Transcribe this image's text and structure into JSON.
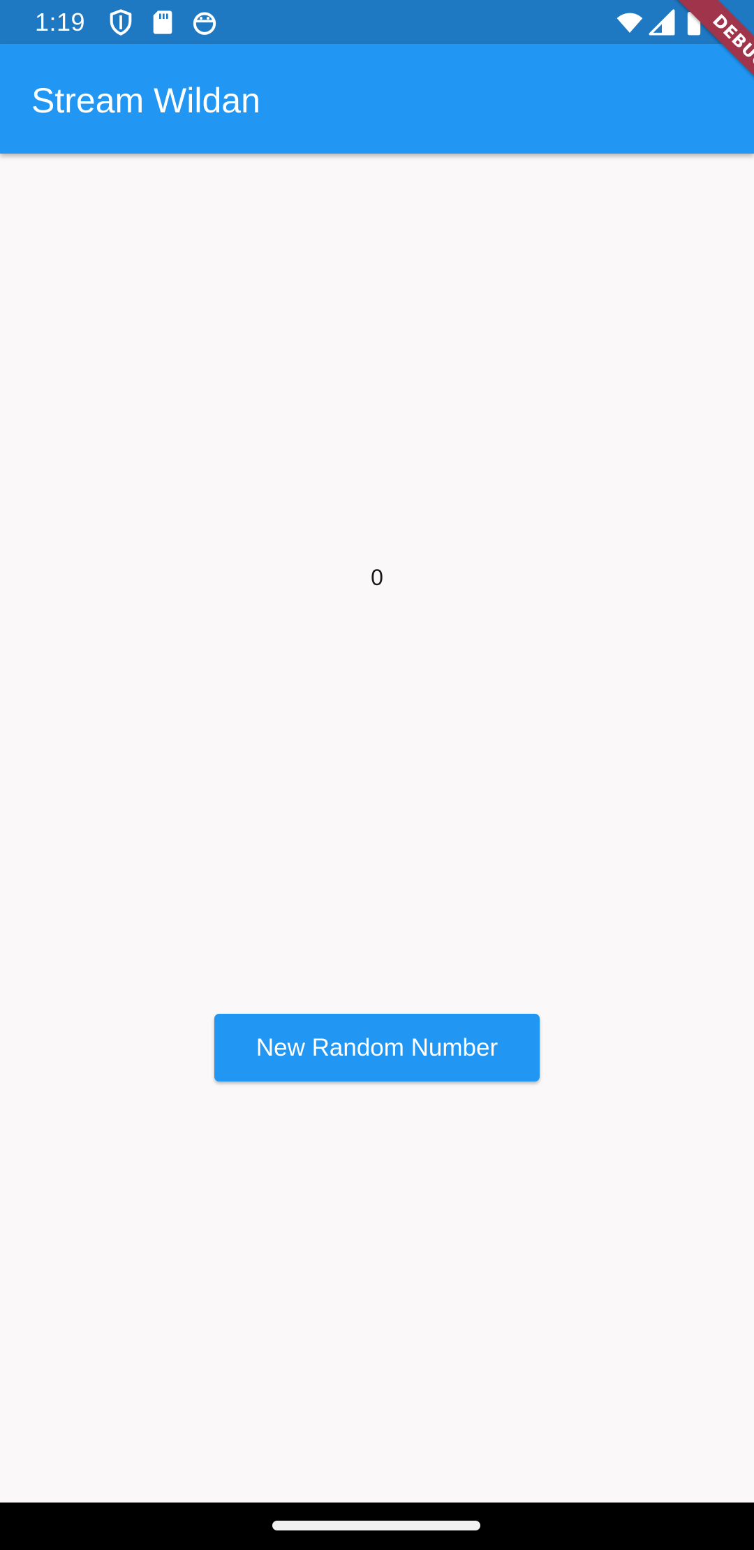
{
  "status_bar": {
    "time": "1:19",
    "left_icons": [
      "shield-icon",
      "sd-card-icon",
      "android-icon"
    ],
    "right_icons": [
      "wifi-icon",
      "cellular-signal-icon",
      "battery-icon"
    ],
    "color": "#1e78c2"
  },
  "app_bar": {
    "title": "Stream Wildan",
    "color": "#2196f3"
  },
  "debug_banner": {
    "label": "DEBUG",
    "color": "#a0344a"
  },
  "main": {
    "value": "0",
    "button_label": "New Random Number",
    "button_color": "#2196f3",
    "background": "#faf8f8"
  },
  "nav_bar": {
    "color": "#000000"
  }
}
